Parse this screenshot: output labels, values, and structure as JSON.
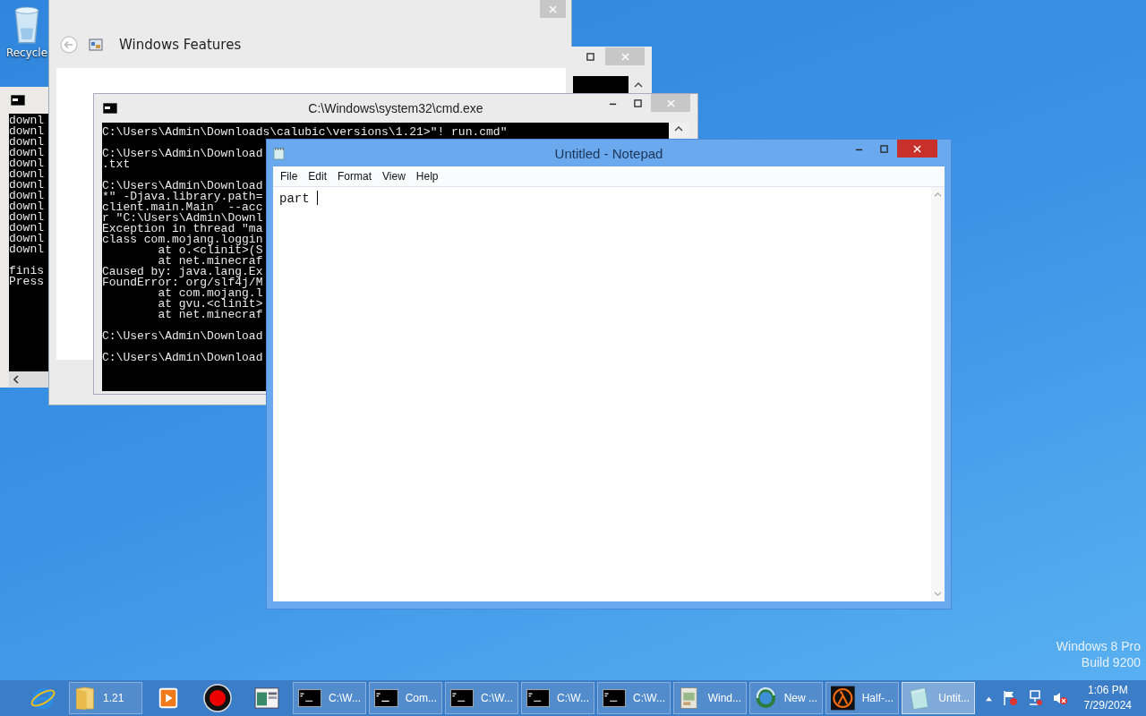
{
  "desktop": {
    "icon_label": "Recycle",
    "edition": [
      "Windows 8 Pro",
      "Build 9200"
    ]
  },
  "back_console": {
    "blocks": [
      [
        "downl",
        "downl",
        "downl",
        "downl",
        "downl",
        "downl",
        "downl",
        "downl",
        "downl",
        "downl",
        "downl",
        "downl",
        "downl"
      ],
      [
        "finis",
        "Press"
      ]
    ]
  },
  "features_window": {
    "title": "Windows Features"
  },
  "cmd_window": {
    "title": "C:\\Windows\\system32\\cmd.exe",
    "blocks": [
      [
        "C:\\Users\\Admin\\Downloads\\calubic\\versions\\1.21>\"! run.cmd\""
      ],
      [
        "C:\\Users\\Admin\\Download",
        ".txt"
      ],
      [
        "C:\\Users\\Admin\\Download",
        "*\" -Djava.library.path=",
        "client.main.Main  --acc",
        "r \"C:\\Users\\Admin\\Downl",
        "Exception in thread \"ma",
        "class com.mojang.loggin",
        "        at o.<clinit>(S",
        "        at net.minecraf",
        "Caused by: java.lang.Ex",
        "FoundError: org/slf4j/M",
        "        at com.mojang.l",
        "        at gvu.<clinit>",
        "        at net.minecraf"
      ],
      [
        "C:\\Users\\Admin\\Download"
      ],
      [
        "C:\\Users\\Admin\\Download"
      ]
    ]
  },
  "notepad": {
    "title": "Untitled - Notepad",
    "active": true,
    "menu": [
      "File",
      "Edit",
      "Format",
      "View",
      "Help"
    ],
    "text": "part "
  },
  "taskbar": {
    "items": [
      {
        "kind": "ie",
        "selected": false
      },
      {
        "kind": "folder",
        "label": "1.21",
        "selected": false
      },
      {
        "kind": "media",
        "selected": false
      },
      {
        "kind": "record",
        "selected": false
      },
      {
        "kind": "app",
        "selected": false
      },
      {
        "kind": "cmd",
        "label": "C:\\W...",
        "selected": false
      },
      {
        "kind": "cmd",
        "label": "Com...",
        "selected": false
      },
      {
        "kind": "cmd",
        "label": "C:\\W...",
        "selected": false
      },
      {
        "kind": "cmd",
        "label": "C:\\W...",
        "selected": false
      },
      {
        "kind": "cmd",
        "label": "C:\\W...",
        "selected": false
      },
      {
        "kind": "features",
        "label": "Wind...",
        "selected": false
      },
      {
        "kind": "globe",
        "label": "New ...",
        "selected": false
      },
      {
        "kind": "lambda",
        "label": "Half-...",
        "selected": false
      },
      {
        "kind": "notepad",
        "label": "Untit...",
        "selected": true
      }
    ],
    "clock": {
      "time": "1:06 PM",
      "date": "7/29/2024"
    }
  }
}
